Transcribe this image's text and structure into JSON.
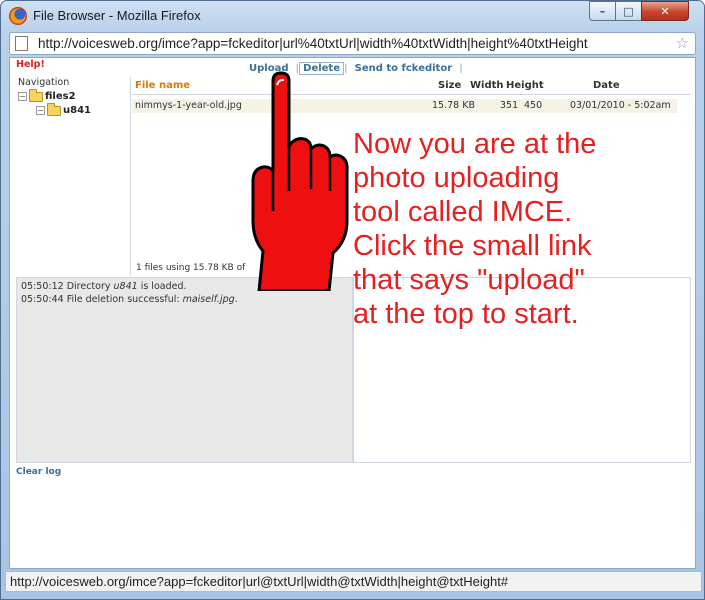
{
  "window": {
    "title": "File Browser - Mozilla Firefox",
    "minimize_glyph": "–",
    "maximize_glyph": "□",
    "close_glyph": "✕"
  },
  "urlbar": {
    "url": "http://voicesweb.org/imce?app=fckeditor|url%40txtUrl|width%40txtWidth|height%40txtHeight",
    "star_glyph": "☆"
  },
  "imce": {
    "help_label": "Help!",
    "ops": {
      "upload": "Upload",
      "delete": "Delete",
      "send": "Send to fckeditor",
      "sep": "|"
    },
    "nav": {
      "title": "Navigation",
      "tree": [
        {
          "label": "files2",
          "toggle": "−"
        },
        {
          "label": "u841",
          "toggle": "−"
        }
      ]
    },
    "files": {
      "headers": {
        "name": "File name",
        "size": "Size",
        "width": "Width",
        "height": "Height",
        "date": "Date"
      },
      "rows": [
        {
          "name": "nimmys-1-year-old.jpg",
          "size": "15.78 KB",
          "width": "351",
          "height": "450",
          "date": "03/01/2010 - 5:02am"
        }
      ],
      "status": "1 files using 15.78 KB of"
    },
    "log": {
      "lines": [
        {
          "time": "05:50:12",
          "text": "Directory ",
          "em": "u841",
          "rest": " is loaded."
        },
        {
          "time": "05:50:44",
          "text": "File deletion successful: ",
          "em": "maiself.jpg",
          "rest": "."
        }
      ]
    },
    "clear_log": "Clear log"
  },
  "annotation": {
    "lines": [
      "Now you are at the",
      "photo uploading",
      "tool called IMCE.",
      "Click the small link",
      "that says \"upload\"",
      "at the top to start."
    ],
    "color": "#e62020"
  },
  "statusbar": {
    "text": "http://voicesweb.org/imce?app=fckeditor|url@txtUrl|width@txtWidth|height@txtHeight#"
  }
}
